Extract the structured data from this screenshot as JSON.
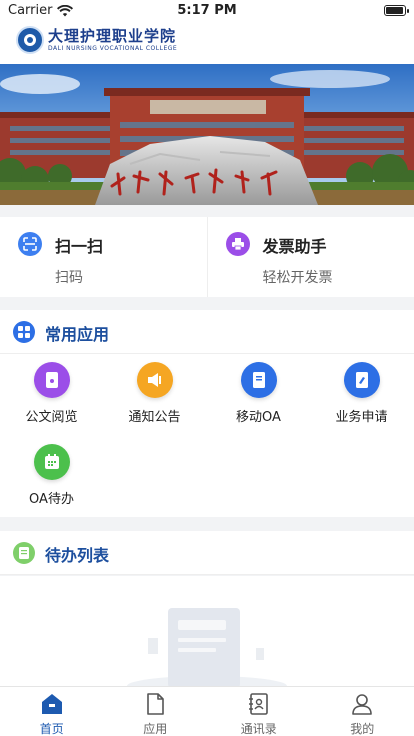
{
  "status_bar": {
    "carrier": "Carrier",
    "time": "5:17 PM",
    "battery_level": 0.95
  },
  "header": {
    "logo_cn": "大理护理职业学院",
    "logo_en": "DALI NURSING VOCATIONAL COLLEGE"
  },
  "quick_actions": [
    {
      "title": "扫一扫",
      "subtitle": "扫码",
      "icon": "scan-icon",
      "color": "#3d7ff0"
    },
    {
      "title": "发票助手",
      "subtitle": "轻松开发票",
      "icon": "printer-icon",
      "color": "#9b4ee8"
    }
  ],
  "common_apps": {
    "title": "常用应用",
    "icon": "grid-icon",
    "color": "#2d6fe5",
    "items": [
      {
        "label": "公文阅览",
        "icon": "document-icon",
        "color": "#9b4ee8"
      },
      {
        "label": "通知公告",
        "icon": "notice-icon",
        "color": "#f5a623"
      },
      {
        "label": "移动OA",
        "icon": "book-icon",
        "color": "#2d6fe5"
      },
      {
        "label": "业务申请",
        "icon": "form-icon",
        "color": "#2d6fe5"
      },
      {
        "label": "OA待办",
        "icon": "calendar-icon",
        "color": "#4cc04c"
      }
    ]
  },
  "todo": {
    "title": "待办列表",
    "icon": "list-icon",
    "color": "#7fcf6a"
  },
  "tabbar": {
    "active_color": "#1d5ab0",
    "tabs": [
      {
        "label": "首页",
        "icon": "home-icon",
        "active": true
      },
      {
        "label": "应用",
        "icon": "file-icon",
        "active": false
      },
      {
        "label": "通讯录",
        "icon": "contacts-icon",
        "active": false
      },
      {
        "label": "我的",
        "icon": "user-icon",
        "active": false
      }
    ]
  }
}
